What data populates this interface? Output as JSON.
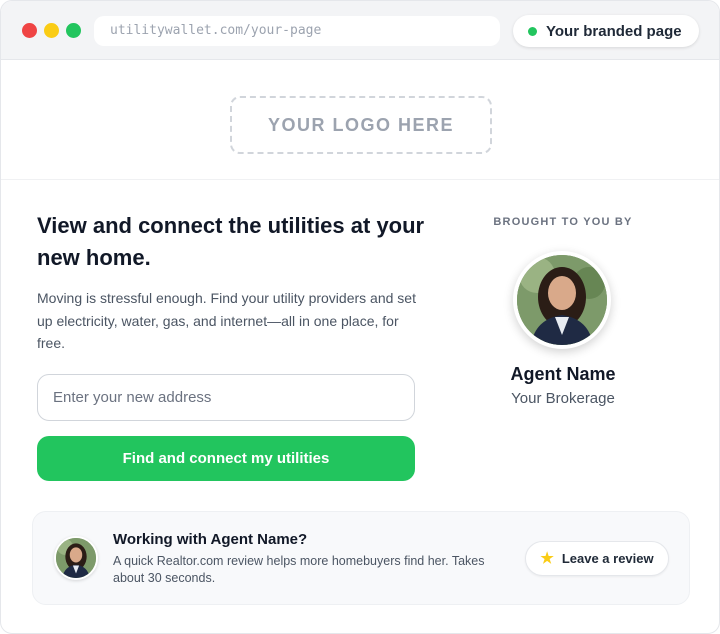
{
  "browser": {
    "url": "utilitywallet.com/your-page",
    "badge_label": "Your branded page"
  },
  "logo": {
    "placeholder_text": "YOUR LOGO HERE"
  },
  "hero": {
    "headline": "View and connect the utilities at your new home.",
    "subtext": "Moving is stressful enough. Find your utility providers and set up electricity, water, gas, and internet—all in one place, for free.",
    "address_placeholder": "Enter your new address",
    "cta_label": "Find and connect my utilities"
  },
  "agent": {
    "brought_to_you_by": "BROUGHT TO YOU BY",
    "name": "Agent Name",
    "brokerage": "Your Brokerage"
  },
  "review": {
    "title": "Working with Agent Name?",
    "description": "A quick Realtor.com review helps more homebuyers find her. Takes about 30 seconds.",
    "button_label": "Leave a review",
    "button_icon": "star-icon"
  },
  "colors": {
    "accent_green": "#22c55e",
    "star_yellow": "#facc15"
  }
}
